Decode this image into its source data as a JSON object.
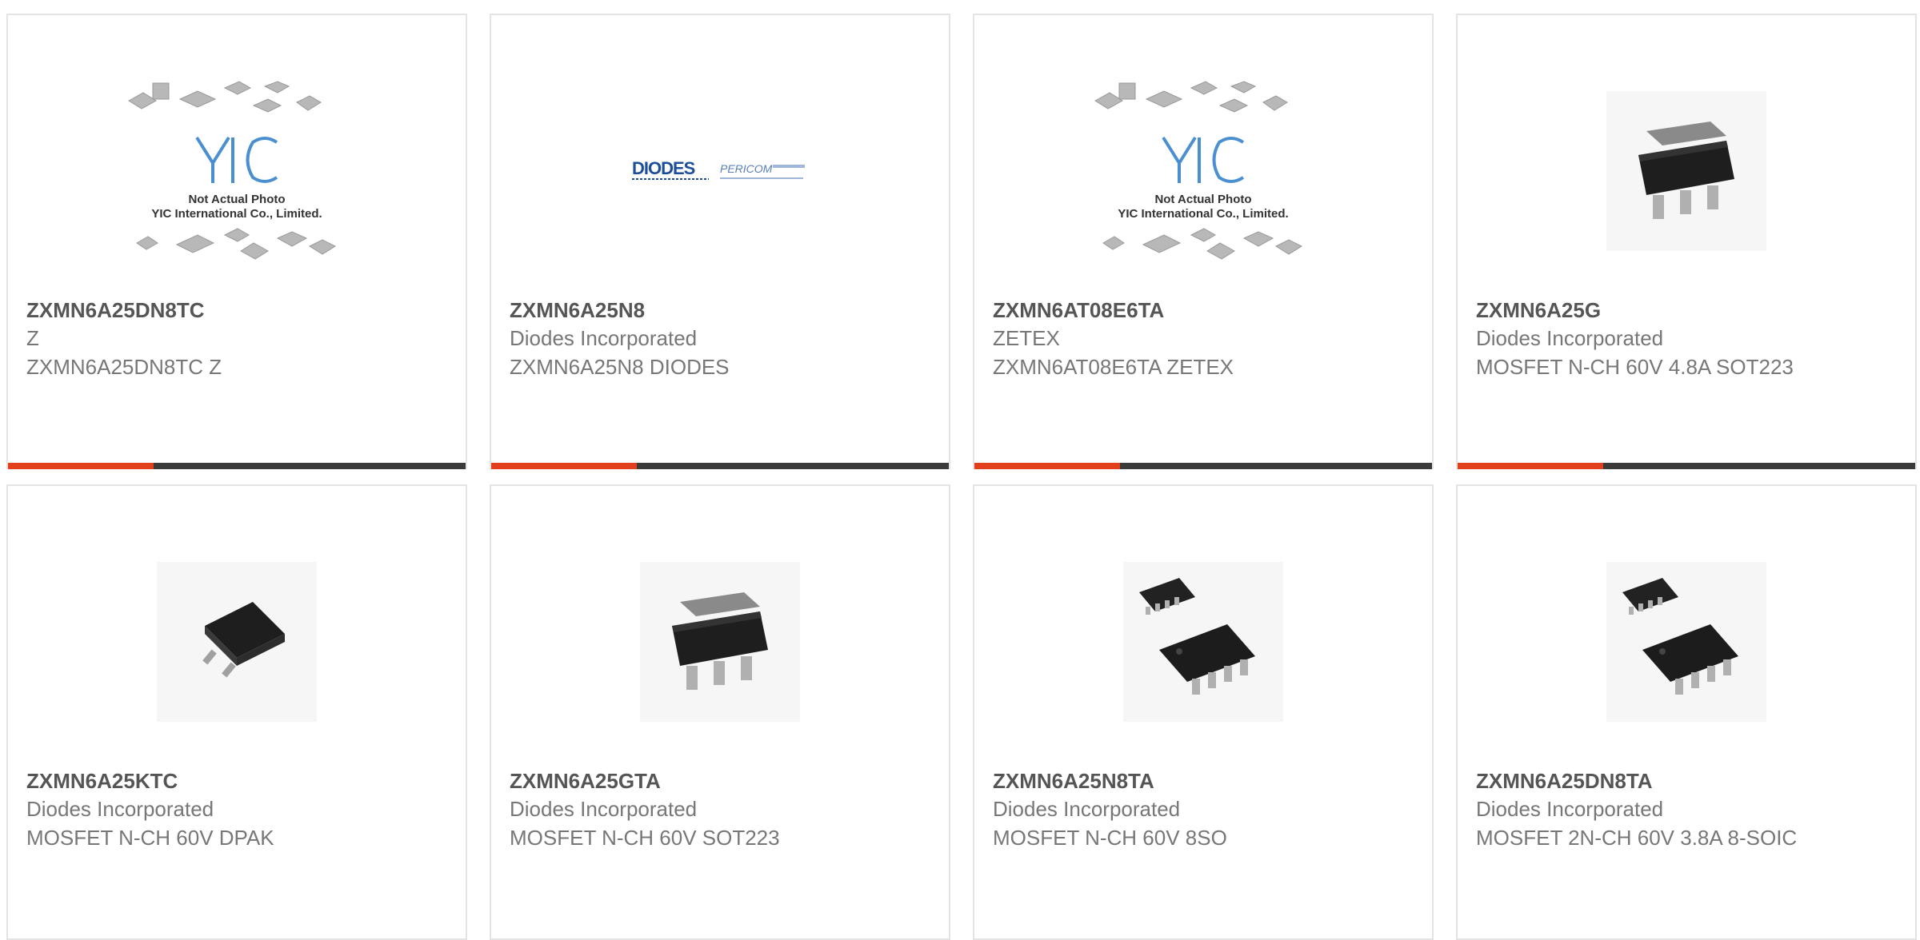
{
  "colors": {
    "accent": "#e2401c",
    "bar_dark": "#3a3a3a",
    "border": "#e3e3e3"
  },
  "cards": [
    {
      "part": "ZXMN6A25DN8TC",
      "maker": "Z",
      "desc": "ZXMN6A25DN8TC Z",
      "image": "yic-placeholder-photo",
      "logo_line1": "Not Actual Photo",
      "logo_line2": "YIC International Co., Limited.",
      "logo_mark": "YIC"
    },
    {
      "part": "ZXMN6A25N8",
      "maker": "Diodes Incorporated",
      "desc": "ZXMN6A25N8 DIODES",
      "image": "diodes-pericom-logo",
      "logo_a": "DIODES",
      "logo_b": "PERICOM"
    },
    {
      "part": "ZXMN6AT08E6TA",
      "maker": "ZETEX",
      "desc": "ZXMN6AT08E6TA ZETEX",
      "image": "yic-placeholder-photo",
      "logo_line1": "Not Actual Photo",
      "logo_line2": "YIC International Co., Limited.",
      "logo_mark": "YIC"
    },
    {
      "part": "ZXMN6A25G",
      "maker": "Diodes Incorporated",
      "desc": "MOSFET N-CH 60V 4.8A SOT223",
      "image": "sot223-package-photo"
    },
    {
      "part": "ZXMN6A25KTC",
      "maker": "Diodes Incorporated",
      "desc": "MOSFET N-CH 60V DPAK",
      "image": "dpak-package-photo"
    },
    {
      "part": "ZXMN6A25GTA",
      "maker": "Diodes Incorporated",
      "desc": "MOSFET N-CH 60V SOT223",
      "image": "sot223-package-photo"
    },
    {
      "part": "ZXMN6A25N8TA",
      "maker": "Diodes Incorporated",
      "desc": "MOSFET N-CH 60V 8SO",
      "image": "soic8-package-photo"
    },
    {
      "part": "ZXMN6A25DN8TA",
      "maker": "Diodes Incorporated",
      "desc": "MOSFET 2N-CH 60V 3.8A 8-SOIC",
      "image": "soic8-package-photo"
    }
  ]
}
